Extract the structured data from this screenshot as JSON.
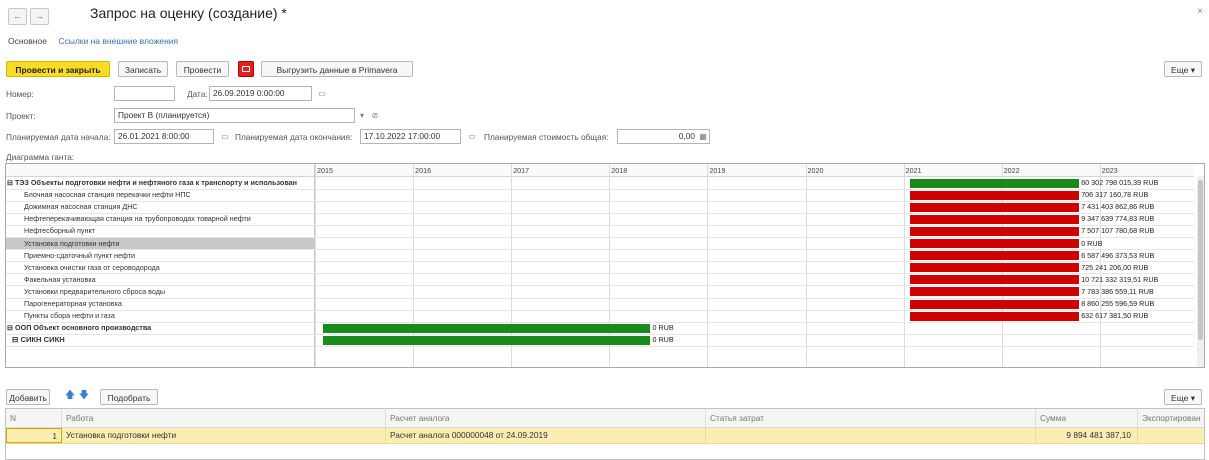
{
  "window": {
    "title": "Запрос на оценку (создание) *",
    "close_icon": "×",
    "back_icon": "←",
    "forward_icon": "→"
  },
  "tabs": {
    "main": "Основное",
    "links": "Ссылки на внешние вложения"
  },
  "toolbar": {
    "post_close": "Провести и закрыть",
    "save": "Записать",
    "post": "Провести",
    "export": "Выгрузить данные в Primavera",
    "more": "Еще ▾"
  },
  "form": {
    "number_label": "Номер:",
    "number_value": "",
    "date_label": "Дата:",
    "date_value": "26.09.2019  0:00:00",
    "project_label": "Проект:",
    "project_value": "Проект В (планируется)",
    "start_label": "Планируемая дата начала:",
    "start_value": "26.01.2021  8:00:00",
    "end_label": "Планируемая дата окончания:",
    "end_value": "17.10.2022 17:00:00",
    "cost_label": "Планируемая стоимость общая:",
    "cost_value": "0,00",
    "gantt_label": "Диаграмма ганта:"
  },
  "gantt": {
    "years": [
      "2015",
      "2016",
      "2017",
      "2018",
      "2019",
      "2020",
      "2021",
      "2022",
      "2023"
    ],
    "rows": [
      {
        "label": "⊟ ТЭЗ Объекты подготовки нефти и нефтяного газа к транспорту и использованию",
        "kind": "group",
        "color": "#1a8a1a",
        "start": 2021.07,
        "end": 2022.79,
        "value": "60 302 798 015,39 RUB"
      },
      {
        "label": "Блочная насосная станция перекачки нефти НПС",
        "kind": "item",
        "color": "#d10000",
        "start": 2021.07,
        "end": 2022.79,
        "value": "706 317 160,78 RUB"
      },
      {
        "label": "Дожимная насосная станция ДНС",
        "kind": "item",
        "color": "#d10000",
        "start": 2021.07,
        "end": 2022.79,
        "value": "7 431 403 862,86 RUB"
      },
      {
        "label": "Нефтеперекачивающая станция на трубопроводах товарной нефти",
        "kind": "item",
        "color": "#d10000",
        "start": 2021.07,
        "end": 2022.79,
        "value": "9 347 639 774,83 RUB"
      },
      {
        "label": "Нефтесборный пункт",
        "kind": "item",
        "color": "#d10000",
        "start": 2021.07,
        "end": 2022.79,
        "value": "7 507 107 780,68 RUB"
      },
      {
        "label": "Установка подготовки нефти",
        "kind": "item-selected",
        "color": "#d10000",
        "start": 2021.07,
        "end": 2022.79,
        "value": "0 RUB"
      },
      {
        "label": "Приемно-сдаточный пункт нефти",
        "kind": "item",
        "color": "#d10000",
        "start": 2021.07,
        "end": 2022.79,
        "value": "6 587 496 373,53 RUB"
      },
      {
        "label": "Установка очистки газа от сероводорода",
        "kind": "item",
        "color": "#d10000",
        "start": 2021.07,
        "end": 2022.79,
        "value": "725 241 206,00 RUB"
      },
      {
        "label": "Факельная установка",
        "kind": "item",
        "color": "#d10000",
        "start": 2021.07,
        "end": 2022.79,
        "value": "10 721 332 319,51 RUB"
      },
      {
        "label": "Установки предварительного сброса воды",
        "kind": "item",
        "color": "#d10000",
        "start": 2021.07,
        "end": 2022.79,
        "value": "7 783 386 559,11 RUB"
      },
      {
        "label": "Парогенераторная установка",
        "kind": "item",
        "color": "#d10000",
        "start": 2021.07,
        "end": 2022.79,
        "value": "8 860 255 596,59 RUB"
      },
      {
        "label": "Пункты сбора нефти и газа",
        "kind": "item",
        "color": "#d10000",
        "start": 2021.07,
        "end": 2022.79,
        "value": "632 617 381,50 RUB"
      },
      {
        "label": "⊟ ООП Объект основного производства",
        "kind": "group",
        "color": "#1a8a1a",
        "start": 2015.08,
        "end": 2018.42,
        "value": "0 RUB"
      },
      {
        "label": "⊟ СИКН СИКН",
        "kind": "sub",
        "color": "#1a8a1a",
        "start": 2015.08,
        "end": 2018.42,
        "value": "0 RUB"
      }
    ]
  },
  "table_toolbar": {
    "add": "Добавить",
    "up_icon": "🡅",
    "down_icon": "🡇",
    "pick": "Подобрать",
    "more": "Еще ▾"
  },
  "table": {
    "headers": [
      "N",
      "Работа",
      "Расчет аналога",
      "Статья затрат",
      "Сумма",
      "Экспортирован"
    ],
    "rows": [
      {
        "n": "1",
        "work": "Установка подготовки нефти",
        "calc": "Расчет аналога 000000048 от 24.09.2019",
        "article": "",
        "sum": "9 894 481 387,10",
        "exported": ""
      }
    ]
  }
}
